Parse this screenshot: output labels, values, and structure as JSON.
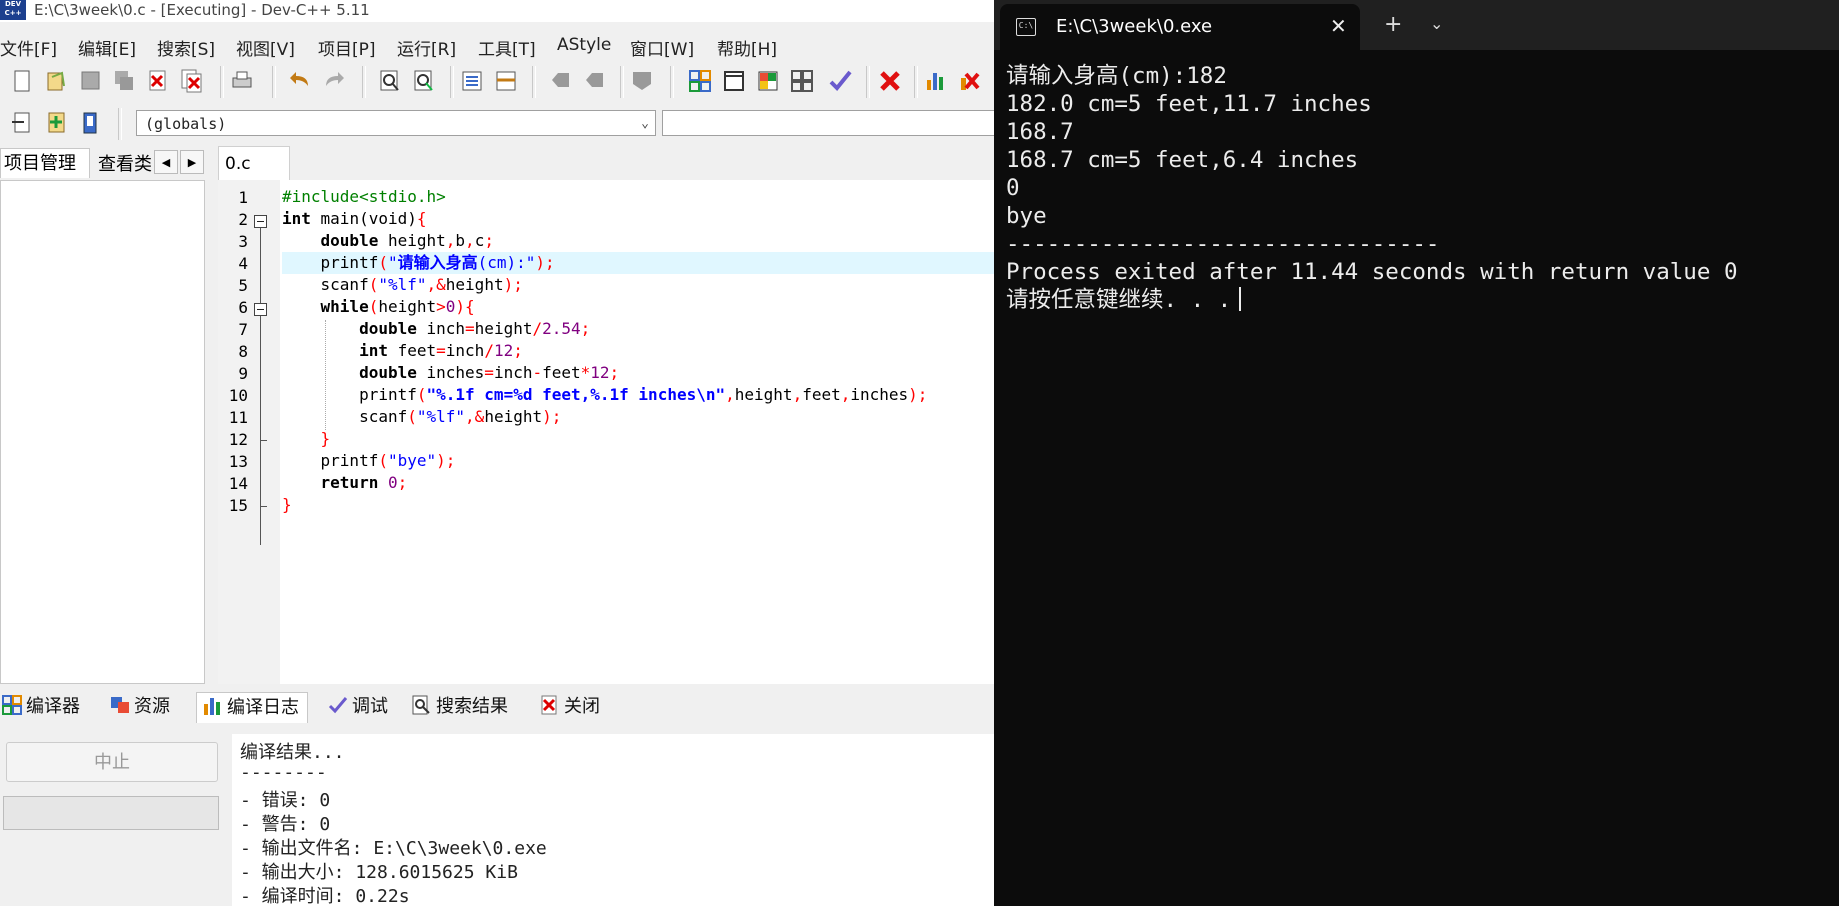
{
  "devcpp": {
    "title": "E:\\C\\3week\\0.c - [Executing] - Dev-C++ 5.11",
    "menu": [
      "文件[F]",
      "编辑[E]",
      "搜索[S]",
      "视图[V]",
      "项目[P]",
      "运行[R]",
      "工具[T]",
      "AStyle",
      "窗口[W]",
      "帮助[H]"
    ],
    "globals_value": "(globals)",
    "left_tabs": [
      "项目管理",
      "查看类"
    ],
    "editor_tab": "0.c",
    "line_numbers": [
      "1",
      "2",
      "3",
      "4",
      "5",
      "6",
      "7",
      "8",
      "9",
      "10",
      "11",
      "12",
      "13",
      "14",
      "15"
    ],
    "bottom_tabs": [
      "编译器",
      "资源",
      "编译日志",
      "调试",
      "搜索结果",
      "关闭"
    ],
    "stop_button": "中止",
    "compile_log": [
      "编译结果...",
      "--------",
      "- 错误: 0",
      "- 警告: 0",
      "- 输出文件名: E:\\C\\3week\\0.exe",
      "- 输出大小: 128.6015625 KiB",
      "- 编译时间: 0.22s"
    ]
  },
  "code": {
    "l1": "#include<stdio.h>",
    "l2a": "int",
    "l2b": " main(void)",
    "l2c": "{",
    "l3a": "double",
    "l3b": " height",
    "l3c": ",",
    "l3d": "b",
    "l3e": ",",
    "l3f": "c",
    "l3g": ";",
    "l4a": "printf",
    "l4b": "(",
    "l4c": "\"",
    "l4d": "请输入身高",
    "l4e": "(cm):\"",
    "l4f": ");",
    "l5a": "scanf",
    "l5b": "(",
    "l5c": "\"%lf\"",
    "l5d": ",&",
    "l5e": "height",
    "l5f": ");",
    "l6a": "while",
    "l6b": "(",
    "l6c": "height",
    "l6d": ">",
    "l6e": "0",
    "l6f": "){",
    "l7a": "double",
    "l7b": " inch",
    "l7c": "=",
    "l7d": "height",
    "l7e": "/",
    "l7f": "2.54",
    "l7g": ";",
    "l8a": "int",
    "l8b": " feet",
    "l8c": "=",
    "l8d": "inch",
    "l8e": "/",
    "l8f": "12",
    "l8g": ";",
    "l9a": "double",
    "l9b": " inches",
    "l9c": "=",
    "l9d": "inch",
    "l9e": "-",
    "l9f": "feet",
    "l9g": "*",
    "l9h": "12",
    "l9i": ";",
    "l10a": "printf",
    "l10b": "(",
    "l10c": "\"%.1f cm=%d feet,%.1f inches\\n\"",
    "l10d": ",",
    "l10e": "height",
    "l10f": ",",
    "l10g": "feet",
    "l10h": ",",
    "l10i": "inches",
    "l10j": ");",
    "l11a": "scanf",
    "l11b": "(",
    "l11c": "\"%lf\"",
    "l11d": ",&",
    "l11e": "height",
    "l11f": ");",
    "l12": "}",
    "l13a": "printf",
    "l13b": "(",
    "l13c": "\"bye\"",
    "l13d": ");",
    "l14a": "return",
    "l14b": " 0",
    "l14c": ";",
    "l15": "}"
  },
  "terminal": {
    "tab_title": "E:\\C\\3week\\0.exe",
    "lines": [
      "请输入身高(cm):182",
      "182.0 cm=5 feet,11.7 inches",
      "168.7",
      "168.7 cm=5 feet,6.4 inches",
      "0",
      "bye",
      "--------------------------------",
      "Process exited after 11.44 seconds with return value 0",
      "请按任意键继续. . ."
    ]
  }
}
